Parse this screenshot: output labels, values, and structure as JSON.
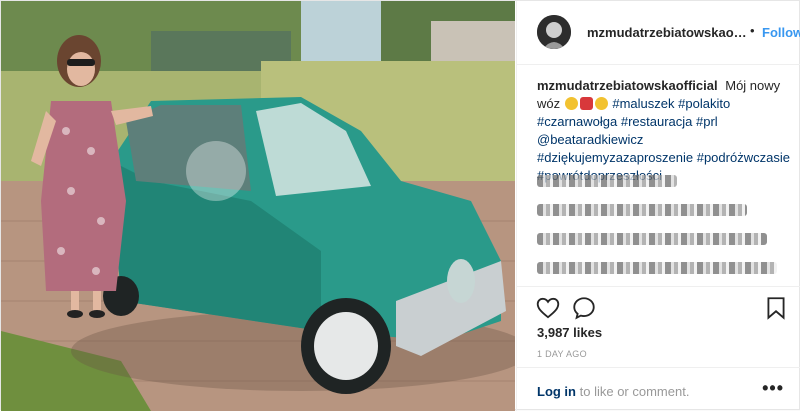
{
  "post": {
    "username": "mzmudatrzebiatowskaoffi...",
    "follow_sep": "•",
    "follow_label": "Follow",
    "caption": {
      "author": "mzmudatrzebiatowskaofficial",
      "text_1": "Mój nowy",
      "text_2": "wóz",
      "tag_1": "#maluszek",
      "tag_2": "#polakito",
      "tag_3": "#czarnawołga",
      "tag_4": "#restauracja",
      "tag_5": "#prl",
      "mention": "@beataradkiewicz",
      "tag_6": "#dziękujemyzazaproszenie",
      "tag_7": "#podróżwczasie",
      "tag_8": "#powrótdoprzeszłości"
    },
    "likes": "3,987 likes",
    "time": "1 DAY AGO",
    "login": {
      "link": "Log in",
      "rest": "to like or comment."
    },
    "more": "•••"
  },
  "icons": [
    "heart-icon",
    "comment-icon",
    "bookmark-icon",
    "more-options-icon"
  ],
  "colors": {
    "accent": "#3897f0",
    "link": "#003569",
    "muted": "#999999",
    "car": "#2a9a8a"
  }
}
